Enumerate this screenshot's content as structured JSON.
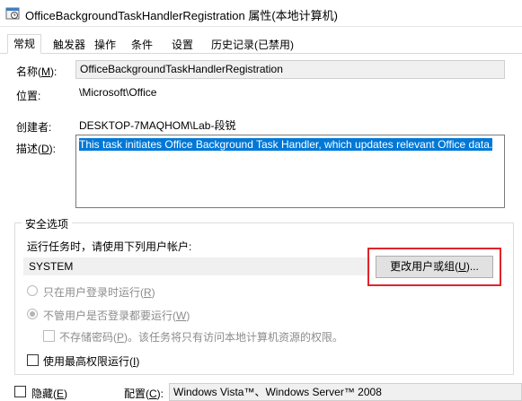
{
  "window": {
    "title": "OfficeBackgroundTaskHandlerRegistration 属性(本地计算机)"
  },
  "tabs": [
    {
      "label": "常规",
      "active": true
    },
    {
      "label": "触发器",
      "active": false
    },
    {
      "label": "操作",
      "active": false
    },
    {
      "label": "条件",
      "active": false
    },
    {
      "label": "设置",
      "active": false
    },
    {
      "label": "历史记录(已禁用)",
      "active": false
    }
  ],
  "general": {
    "name_label_pre": "名称(",
    "name_label_key": "M",
    "name_label_post": "):",
    "name_value": "OfficeBackgroundTaskHandlerRegistration",
    "location_label": "位置:",
    "location_value": "\\Microsoft\\Office",
    "author_label": "创建者:",
    "author_value": "DESKTOP-7MAQHOM\\Lab-段锐",
    "description_label_pre": "描述(",
    "description_label_key": "D",
    "description_label_post": "):",
    "description_value": "This task initiates Office Background Task Handler, which updates relevant Office data."
  },
  "security": {
    "legend": "安全选项",
    "run_as_prompt": "运行任务时，请使用下列用户帐户:",
    "account": "SYSTEM",
    "change_button_pre": "更改用户或组(",
    "change_button_key": "U",
    "change_button_post": ")...",
    "radio_logged_on_pre": "只在用户登录时运行(",
    "radio_logged_on_key": "R",
    "radio_logged_on_post": ")",
    "radio_whether_pre": "不管用户是否登录都要运行(",
    "radio_whether_key": "W",
    "radio_whether_post": ")",
    "no_store_pwd_pre": "不存储密码(",
    "no_store_pwd_key": "P",
    "no_store_pwd_post": ")。该任务将只有访问本地计算机资源的权限。",
    "highest_priv_pre": "使用最高权限运行(",
    "highest_priv_key": "I",
    "highest_priv_post": ")"
  },
  "bottom": {
    "hidden_pre": "隐藏(",
    "hidden_key": "E",
    "hidden_post": ")",
    "configure_pre": "配置(",
    "configure_key": "C",
    "configure_post": "):",
    "configure_value": "Windows Vista™、Windows Server™ 2008"
  },
  "colors": {
    "highlight": "#0078d7",
    "annotation_red": "#e0242a"
  }
}
